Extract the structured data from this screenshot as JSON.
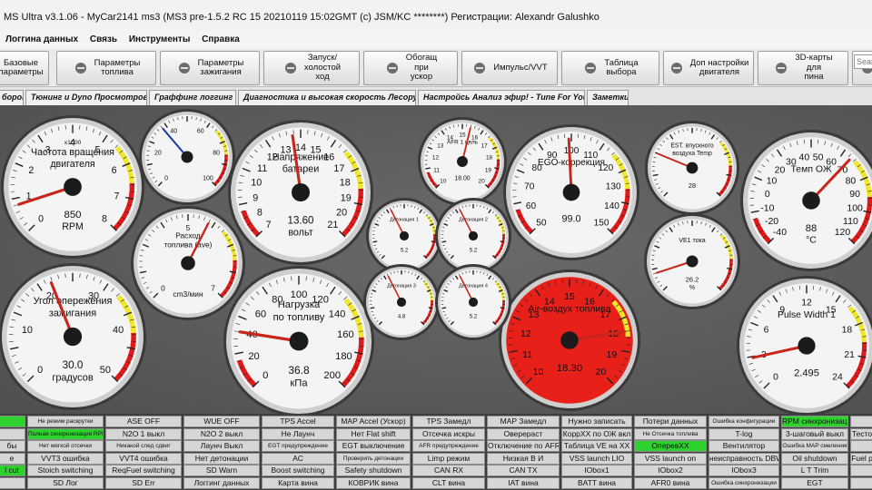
{
  "window": {
    "title": "MS Ultra v3.1.06 - MyCar2141 ms3 (MS3 pre-1.5.2 RC 15   20210119 15:02GMT (c) JSM/KC ********) Регистрации: Alexandr Galushko"
  },
  "menu": [
    "Логгина данных",
    "Связь",
    "Инструменты",
    "Справка"
  ],
  "toolbar": [
    {
      "label": "Базовые\nпараметры",
      "icon": "settings-icon"
    },
    {
      "label": "Параметры\nтоплива",
      "icon": "injector-icon"
    },
    {
      "label": "Параметры\nзажигания",
      "icon": "spark-plug-icon"
    },
    {
      "label": "Запуск/\nхолостой\nход",
      "icon": "idle-valve-icon"
    },
    {
      "label": "Обогащ\nпри\nускор",
      "icon": "accel-icon"
    },
    {
      "label": "Импульс/VVT",
      "icon": "turbo-icon"
    },
    {
      "label": "Таблица\nвыбора",
      "icon": "table-icon"
    },
    {
      "label": "Доп настройки\nдвигателя",
      "icon": "gears-icon"
    },
    {
      "label": "3D-карты\nдля\nпина",
      "icon": "wrench-icon"
    },
    {
      "label": "",
      "icon": "tool-icon"
    }
  ],
  "search": {
    "placeholder": "Sear"
  },
  "tabs": [
    "боров",
    "Тюнинг и Dyno Просмотров",
    "Граффинг логгинг",
    "Диагностика и высокая скорость Лесорубы",
    "Настройсь Анализ эфир! - Tune For You",
    "Заметки"
  ],
  "colors": {
    "gauge_face": "#f4f4f4",
    "redline": "#e01a1a",
    "yellowline": "#f0e62a",
    "needle": "#c8251b",
    "indicator_on": "#2fd12f",
    "indicator_off": "#d6d6d6"
  },
  "gauges": [
    {
      "id": "rpm",
      "title": "Частота вращения\nдвигателя",
      "sub": "x1000",
      "value": "850",
      "unit": "RPM",
      "ticks": [
        "0",
        "1",
        "2",
        "3",
        "4",
        "5",
        "6",
        "7",
        "8"
      ],
      "needle": 0.1
    },
    {
      "id": "small-top",
      "title": "",
      "sub": "",
      "value": "",
      "unit": "",
      "ticks": [
        "0",
        "20",
        "40",
        "60",
        "80",
        "100"
      ],
      "needle": 0.35
    },
    {
      "id": "battery",
      "title": "Напряжение\nбатареи",
      "sub": "",
      "value": "13.60",
      "unit": "вольт",
      "ticks": [
        "7",
        "8",
        "9",
        "10",
        "11",
        "12",
        "13",
        "14",
        "15",
        "16",
        "17",
        "18",
        "19",
        "20",
        "21"
      ],
      "needle": 0.47
    },
    {
      "id": "afr",
      "title": "AFR 1 цель",
      "sub": "",
      "value": "18.00",
      "unit": "",
      "ticks": [
        "10",
        "11",
        "12",
        "13",
        "14",
        "15",
        "16",
        "17",
        "18",
        "19",
        "20"
      ],
      "needle": 0.55
    },
    {
      "id": "ego",
      "title": "EGO-коррекция",
      "sub": "",
      "value": "99.0",
      "unit": "",
      "ticks": [
        "50",
        "60",
        "70",
        "80",
        "90",
        "100",
        "110",
        "120",
        "130",
        "140",
        "150"
      ],
      "needle": 0.49
    },
    {
      "id": "est",
      "title": "EST. впускного\nвоздуха Temp",
      "sub": "",
      "value": "28",
      "unit": "",
      "ticks": [],
      "needle": 0.25
    },
    {
      "id": "coolant",
      "title": "Темп ОЖ",
      "sub": "",
      "value": "88",
      "unit": "°C",
      "ticks": [
        "-40",
        "-20",
        "-10",
        "0",
        "10",
        "20",
        "30",
        "40",
        "50",
        "60",
        "70",
        "80",
        "90",
        "100",
        "110",
        "120"
      ],
      "needle": 0.66
    },
    {
      "id": "fuel-flow",
      "title": "Расход\nтоплива (ave)",
      "sub": "",
      "value": "",
      "unit": "cm3/мин",
      "ticks": [
        "0",
        "5",
        "7"
      ],
      "needle": 0.6
    },
    {
      "id": "ve",
      "title": "VE1 тока",
      "sub": "",
      "value": "26.2",
      "unit": "%",
      "ticks": [],
      "needle": 0.1
    },
    {
      "id": "timing",
      "title": "Угол опережения\nзажигания",
      "sub": "",
      "value": "30.0",
      "unit": "градусов",
      "ticks": [
        "0",
        "10",
        "20",
        "30",
        "40",
        "50"
      ],
      "needle": 0.42
    },
    {
      "id": "load",
      "title": "Нагрузка\nпо топливу",
      "sub": "",
      "value": "36.8",
      "unit": "кПа",
      "ticks": [
        "0",
        "20",
        "40",
        "60",
        "80",
        "100",
        "120",
        "140",
        "160",
        "180",
        "200"
      ],
      "needle": 0.2
    },
    {
      "id": "air-fuel",
      "title": "Air-воздух топлива",
      "sub": "",
      "value": "18.30",
      "unit": "",
      "ticks": [
        "10",
        "11",
        "12",
        "13",
        "14",
        "15",
        "16",
        "17",
        "18",
        "19",
        "20"
      ],
      "needle": 0.8
    },
    {
      "id": "pulse",
      "title": "Pulse Width 1",
      "sub": "",
      "value": "2.495",
      "unit": "",
      "ticks": [
        "0",
        "3",
        "6",
        "9",
        "12",
        "15",
        "18",
        "21",
        "24"
      ],
      "needle": 0.12
    },
    {
      "id": "knock1",
      "title": "Детонация 1",
      "sub": "",
      "value": "5.2",
      "unit": "",
      "ticks": [],
      "needle": 0.4
    },
    {
      "id": "knock2",
      "title": "Детонация 2",
      "sub": "",
      "value": "5.2",
      "unit": "",
      "ticks": [],
      "needle": 0.4
    },
    {
      "id": "knock3",
      "title": "Детонация 3",
      "sub": "",
      "value": "4.8",
      "unit": "",
      "ticks": [],
      "needle": 0.4
    },
    {
      "id": "knock4",
      "title": "Детонация 4",
      "sub": "",
      "value": "5.2",
      "unit": "",
      "ticks": [],
      "needle": 0.4
    }
  ],
  "indicators": [
    [
      {
        "label": "",
        "on": true
      },
      {
        "label": "Не режим раскрутки",
        "on": false
      },
      {
        "label": "ASE OFF",
        "on": false
      },
      {
        "label": "WUE OFF",
        "on": false
      },
      {
        "label": "TPS Accel",
        "on": false
      },
      {
        "label": "MAP Accel (Ускор)",
        "on": false
      },
      {
        "label": "TPS Замедл",
        "on": false
      },
      {
        "label": "MAP Замедл",
        "on": false
      },
      {
        "label": "Нужно записать",
        "on": false
      },
      {
        "label": "Потери данных",
        "on": false
      },
      {
        "label": "Ошибка конфигурации",
        "on": false
      },
      {
        "label": "RPM синхронизации",
        "on": true
      },
      {
        "label": "",
        "on": false
      }
    ],
    [
      {
        "label": "",
        "on": false
      },
      {
        "label": "Полная синхронизация RPM",
        "on": true
      },
      {
        "label": "N2O 1 выкл",
        "on": false
      },
      {
        "label": "N2O 2 выкл",
        "on": false
      },
      {
        "label": "Не Лаунч",
        "on": false
      },
      {
        "label": "Нет Flat shift",
        "on": false
      },
      {
        "label": "Отсечка искры",
        "on": false
      },
      {
        "label": "Оверераст",
        "on": false
      },
      {
        "label": "КоррХХ по ОЖ вкл",
        "on": false
      },
      {
        "label": "Не Отсечка топлива",
        "on": false
      },
      {
        "label": "T-log",
        "on": false
      },
      {
        "label": "3-шаговый выкл",
        "on": false
      },
      {
        "label": "Тесто",
        "on": false
      }
    ],
    [
      {
        "label": "бы",
        "on": false
      },
      {
        "label": "Нет мягкой отсечки",
        "on": false
      },
      {
        "label": "Никакой след сдвиг",
        "on": false
      },
      {
        "label": "Лаунч Выкл",
        "on": false
      },
      {
        "label": "EGT предупреждение",
        "on": false
      },
      {
        "label": "EGT выключение",
        "on": false
      },
      {
        "label": "AFR предупреждение",
        "on": false
      },
      {
        "label": "Отключение по AFR",
        "on": false
      },
      {
        "label": "Таблица VE на XX",
        "on": false
      },
      {
        "label": "ОперевХХ",
        "on": true
      },
      {
        "label": "Вентилятор",
        "on": false
      },
      {
        "label": "Ошибка MAP смеления",
        "on": false
      },
      {
        "label": "",
        "on": false
      }
    ],
    [
      {
        "label": "е",
        "on": false
      },
      {
        "label": "VVT3 ошибка",
        "on": false
      },
      {
        "label": "VVT4 ошибка",
        "on": false
      },
      {
        "label": "Нет детонации",
        "on": false
      },
      {
        "label": "AC",
        "on": false
      },
      {
        "label": "Проверить детонации",
        "on": false
      },
      {
        "label": "Limp режим",
        "on": false
      },
      {
        "label": "Низкая В И",
        "on": false
      },
      {
        "label": "VSS launch LIO",
        "on": false
      },
      {
        "label": "VSS launch on",
        "on": false
      },
      {
        "label": "неисправность DBW",
        "on": false
      },
      {
        "label": "Oil shutdown",
        "on": false
      },
      {
        "label": "Fuel p",
        "on": false
      }
    ],
    [
      {
        "label": "l cut",
        "on": true
      },
      {
        "label": "Stoich switching",
        "on": false
      },
      {
        "label": "ReqFuel switching",
        "on": false
      },
      {
        "label": "SD Warn",
        "on": false
      },
      {
        "label": "Boost switching",
        "on": false
      },
      {
        "label": "Safety shutdown",
        "on": false
      },
      {
        "label": "CAN RX",
        "on": false
      },
      {
        "label": "CAN TX",
        "on": false
      },
      {
        "label": "IObox1",
        "on": false
      },
      {
        "label": "IObox2",
        "on": false
      },
      {
        "label": "IObox3",
        "on": false
      },
      {
        "label": "L T Trim",
        "on": false
      },
      {
        "label": "",
        "on": false
      }
    ],
    [
      {
        "label": "",
        "on": false
      },
      {
        "label": "SD Лог",
        "on": false
      },
      {
        "label": "SD Err",
        "on": false
      },
      {
        "label": "Логгинг данных",
        "on": false
      },
      {
        "label": "Карта вина",
        "on": false
      },
      {
        "label": "КОВРИК вина",
        "on": false
      },
      {
        "label": "CLT вина",
        "on": false
      },
      {
        "label": "IAT вина",
        "on": false
      },
      {
        "label": "BATT вина",
        "on": false
      },
      {
        "label": "AFR0 вина",
        "on": false
      },
      {
        "label": "Ошибка синхронизации",
        "on": false
      },
      {
        "label": "EGT",
        "on": false
      },
      {
        "label": "",
        "on": false
      }
    ]
  ]
}
